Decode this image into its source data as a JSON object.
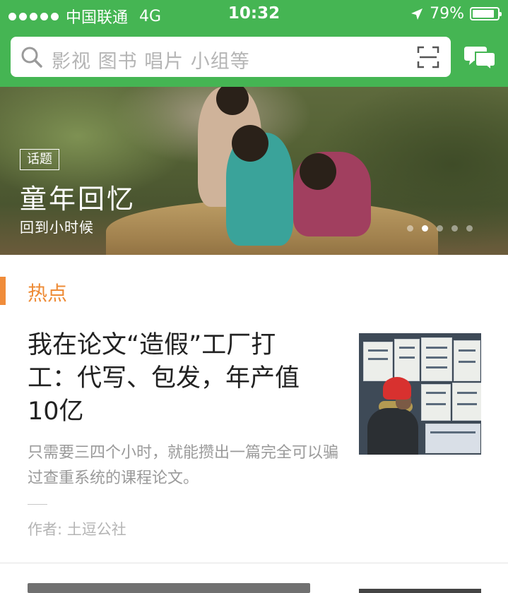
{
  "status_bar": {
    "carrier": "中国联通",
    "network": "4G",
    "time": "10:32",
    "battery": "79%",
    "battery_level": 0.79
  },
  "search": {
    "placeholder": "影视 图书 唱片 小组等"
  },
  "banner": {
    "tag": "话题",
    "title": "童年回忆",
    "subtitle": "回到小时候",
    "pages": 5,
    "active_page": 2
  },
  "section": {
    "title": "热点"
  },
  "article": {
    "title": "我在论文“造假”工厂打工：代写、包发，年产值10亿",
    "summary": "只需要三四个小时，就能攒出一篇完全可以骗过查重系统的课程论文。",
    "author": "作者: 土逗公社"
  },
  "colors": {
    "brand_green": "#45b553",
    "accent_orange": "#ee8b36"
  },
  "icons": [
    "search-icon",
    "scan-icon",
    "chat-icon",
    "location-arrow-icon",
    "battery-icon"
  ]
}
